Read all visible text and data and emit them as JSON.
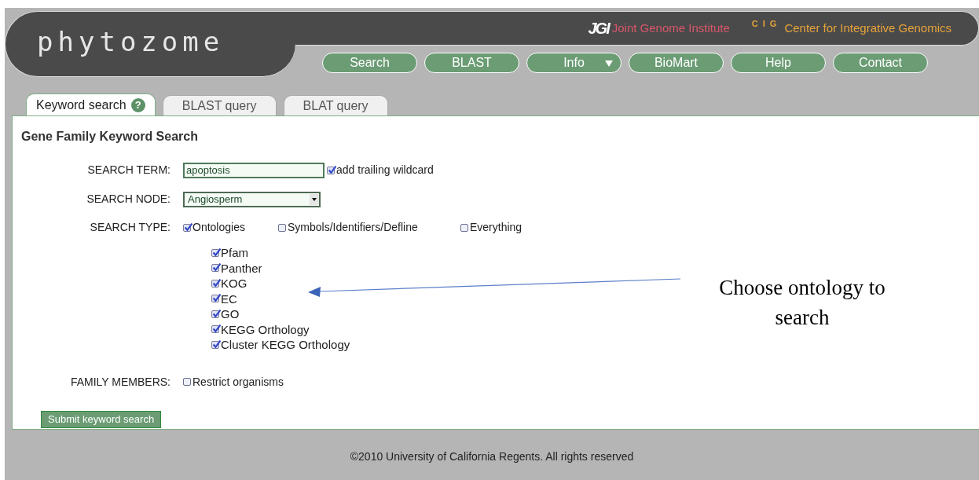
{
  "header": {
    "logo": "phytozome",
    "partners": [
      {
        "mark": "JGI",
        "name": "Joint Genome Institute",
        "color": "#d9566a"
      },
      {
        "mark": "CIG",
        "name": "Center for Integrative Genomics",
        "color": "#e8a33a"
      }
    ]
  },
  "nav": [
    {
      "label": "Search",
      "has_menu": false
    },
    {
      "label": "BLAST",
      "has_menu": false
    },
    {
      "label": "Info",
      "has_menu": true
    },
    {
      "label": "BioMart",
      "has_menu": false
    },
    {
      "label": "Help",
      "has_menu": false
    },
    {
      "label": "Contact",
      "has_menu": false
    }
  ],
  "tabs": [
    {
      "label": "Keyword search",
      "selected": true,
      "help": "?"
    },
    {
      "label": "BLAST query",
      "selected": false
    },
    {
      "label": "BLAT query",
      "selected": false
    }
  ],
  "form": {
    "title": "Gene Family Keyword Search",
    "search_term": {
      "label": "SEARCH TERM:",
      "value": "apoptosis",
      "wildcard": {
        "label": "add trailing wildcard",
        "checked": true
      }
    },
    "search_node": {
      "label": "SEARCH NODE:",
      "value": "Angiosperm"
    },
    "search_type": {
      "label": "SEARCH TYPE:",
      "options": [
        {
          "label": "Ontologies",
          "checked": true
        },
        {
          "label": "Symbols/Identifiers/Defline",
          "checked": false
        },
        {
          "label": "Everything",
          "checked": false
        }
      ]
    },
    "ontologies": [
      {
        "label": "Pfam",
        "checked": true
      },
      {
        "label": "Panther",
        "checked": true
      },
      {
        "label": "KOG",
        "checked": true
      },
      {
        "label": "EC",
        "checked": true
      },
      {
        "label": "GO",
        "checked": true
      },
      {
        "label": "KEGG Orthology",
        "checked": true
      },
      {
        "label": "Cluster KEGG Orthology",
        "checked": true
      }
    ],
    "family_members": {
      "label": "FAMILY MEMBERS:",
      "option": {
        "label": "Restrict organisms",
        "checked": false
      }
    },
    "submit": "Submit keyword search"
  },
  "annotation": "Choose ontology to search",
  "footer": "©2010 University of California Regents. All rights reserved"
}
